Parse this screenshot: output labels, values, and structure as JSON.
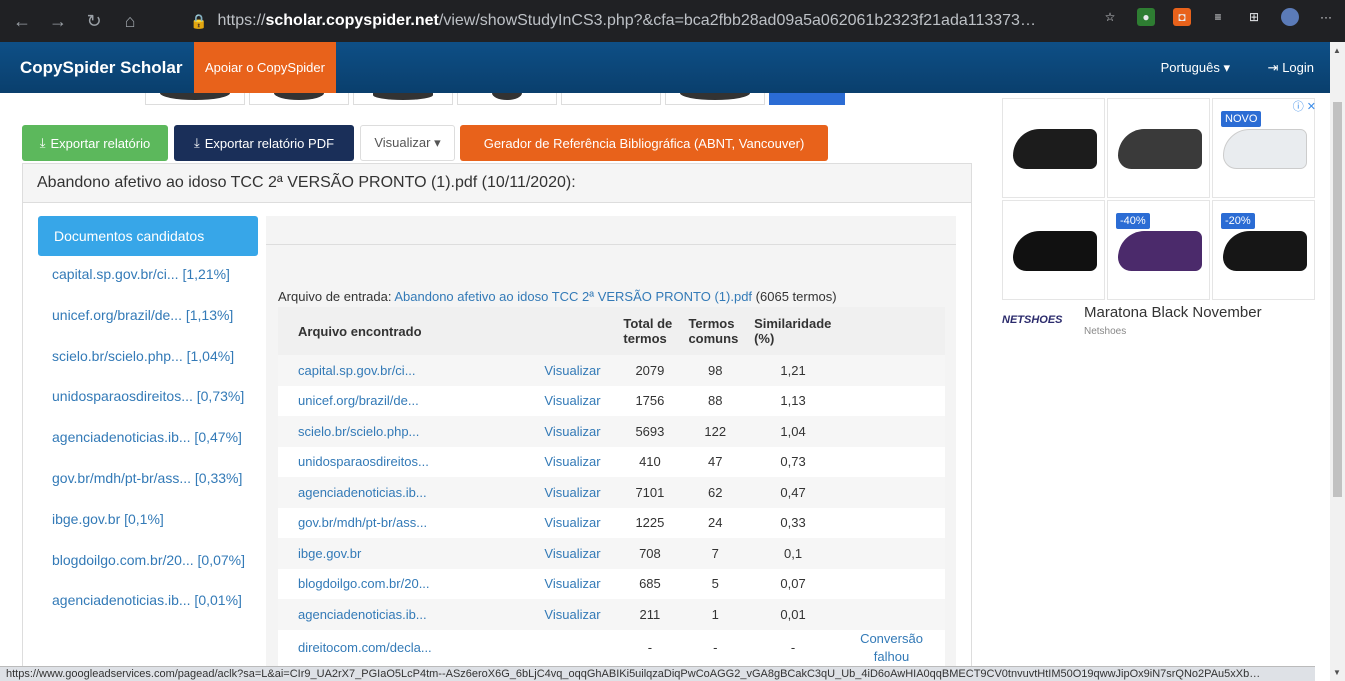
{
  "browser": {
    "url_host": "scholar.copyspider.net",
    "url_prefix": "https://",
    "url_path": "/view/showStudyInCS3.php?&cfa=bca2fbb28ad09a5a062061b2323f21ada113373…",
    "status_url": "https://www.googleadservices.com/pagead/aclk?sa=L&ai=CIr9_UA2rX7_PGIaO5LcP4tm--ASz6eroX6G_6bLjC4vq_oqqGhABIKi5uilqzaDiqPwCoAGG2_vGA8gBCakC3qU_Ub_4iD6oAwHIA0qqBMECT9CV0tnvuvtHtIM50O19qwwJipOx9iN7srQNo2PAu5xXb…"
  },
  "navbar": {
    "brand": "CopySpider Scholar",
    "support": "Apoiar o CopySpider",
    "language": "Português ▾",
    "login": "Login"
  },
  "actions": {
    "export": "Exportar relatório",
    "export_pdf": "Exportar relatório PDF",
    "view": "Visualizar ▾",
    "reference": "Gerador de Referência Bibliográfica (ABNT, Vancouver)"
  },
  "panel": {
    "title": "Abandono afetivo ao idoso TCC 2ª VERSÃO PRONTO (1).pdf (10/11/2020):"
  },
  "candidates": {
    "header": "Documentos candidatos",
    "items": [
      "capital.sp.gov.br/ci... [1,21%]",
      "unicef.org/brazil/de... [1,13%]",
      "scielo.br/scielo.php... [1,04%]",
      "unidosparaosdireitos... [0,73%]",
      "agenciadenoticias.ib... [0,47%]",
      "gov.br/mdh/pt-br/ass... [0,33%]",
      "ibge.gov.br [0,1%]",
      "blogdoilgo.com.br/20... [0,07%]",
      "agenciadenoticias.ib... [0,01%]"
    ]
  },
  "input_file": {
    "label": "Arquivo de entrada:",
    "name": "Abandono afetivo ao idoso TCC 2ª VERSÃO PRONTO (1).pdf",
    "terms": "(6065 termos)"
  },
  "table": {
    "headers": {
      "file": "Arquivo encontrado",
      "total_a": "Total de",
      "total_b": "termos",
      "common_a": "Termos",
      "common_b": "comuns",
      "sim_a": "Similaridade",
      "sim_b": "(%)"
    },
    "rows": [
      {
        "file": "capital.sp.gov.br/ci...",
        "view": "Visualizar",
        "total": "2079",
        "common": "98",
        "sim": "1,21",
        "status": ""
      },
      {
        "file": "unicef.org/brazil/de...",
        "view": "Visualizar",
        "total": "1756",
        "common": "88",
        "sim": "1,13",
        "status": ""
      },
      {
        "file": "scielo.br/scielo.php...",
        "view": "Visualizar",
        "total": "5693",
        "common": "122",
        "sim": "1,04",
        "status": ""
      },
      {
        "file": "unidosparaosdireitos...",
        "view": "Visualizar",
        "total": "410",
        "common": "47",
        "sim": "0,73",
        "status": ""
      },
      {
        "file": "agenciadenoticias.ib...",
        "view": "Visualizar",
        "total": "7101",
        "common": "62",
        "sim": "0,47",
        "status": ""
      },
      {
        "file": "gov.br/mdh/pt-br/ass...",
        "view": "Visualizar",
        "total": "1225",
        "common": "24",
        "sim": "0,33",
        "status": ""
      },
      {
        "file": "ibge.gov.br",
        "view": "Visualizar",
        "total": "708",
        "common": "7",
        "sim": "0,1",
        "status": ""
      },
      {
        "file": "blogdoilgo.com.br/20...",
        "view": "Visualizar",
        "total": "685",
        "common": "5",
        "sim": "0,07",
        "status": ""
      },
      {
        "file": "agenciadenoticias.ib...",
        "view": "Visualizar",
        "total": "211",
        "common": "1",
        "sim": "0,01",
        "status": ""
      },
      {
        "file": "direitocom.com/decla...",
        "view": "",
        "total": "-",
        "common": "-",
        "sim": "-",
        "status": "Conversão falhou"
      }
    ]
  },
  "ad": {
    "brand": "NETSHOES",
    "title": "Maratona Black November",
    "subtitle": "Netshoes",
    "badge_new": "NOVO",
    "badge_40": "-40%",
    "badge_20": "-20%",
    "choices": "ⓘ ✕"
  },
  "colors": {
    "navbar": "#0e4f86",
    "accent_orange": "#e8621b",
    "green": "#5cb85c",
    "link": "#337ab7",
    "candidate_header": "#37a6e8"
  }
}
